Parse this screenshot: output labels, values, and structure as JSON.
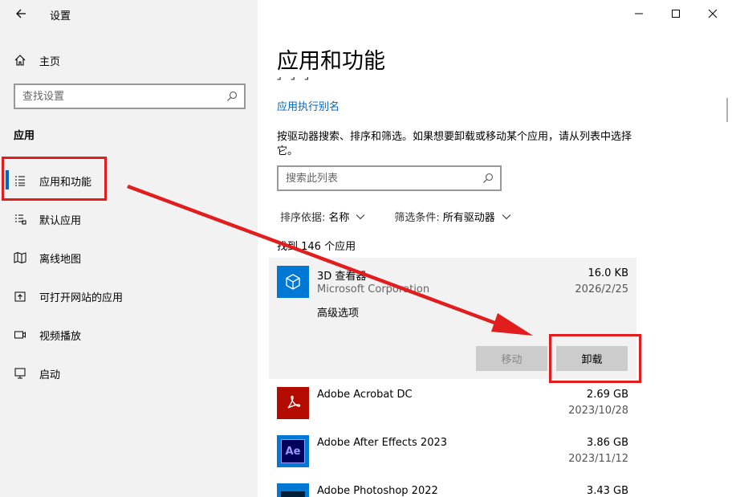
{
  "window": {
    "title": "设置"
  },
  "sidebar": {
    "home_label": "主页",
    "search_placeholder": "查找设置",
    "section_title": "应用",
    "items": [
      {
        "label": "应用和功能"
      },
      {
        "label": "默认应用"
      },
      {
        "label": "离线地图"
      },
      {
        "label": "可打开网站的应用"
      },
      {
        "label": "视频播放"
      },
      {
        "label": "启动"
      }
    ]
  },
  "main": {
    "title": "应用和功能",
    "cut_text": "」 」 」",
    "alias_link": "应用执行别名",
    "description": "按驱动器搜索、排序和筛选。如果想要卸载或移动某个应用，请从列表中选择它。",
    "list_search_placeholder": "搜索此列表",
    "sort": {
      "label": "排序依据:",
      "value": "名称"
    },
    "filter": {
      "label": "筛选条件:",
      "value": "所有驱动器"
    },
    "found_count": "找到 146 个应用",
    "apps": [
      {
        "name": "3D 查看器",
        "publisher": "Microsoft Corporation",
        "size": "16.0 KB",
        "date": "2026/2/25",
        "advanced": "高级选项",
        "icon": "3d-viewer-icon"
      },
      {
        "name": "Adobe Acrobat DC",
        "size": "2.69 GB",
        "date": "2023/10/28",
        "icon": "acrobat-icon"
      },
      {
        "name": "Adobe After Effects 2023",
        "size": "3.86 GB",
        "date": "2023/11/12",
        "icon": "after-effects-icon",
        "icon_text": "Ae"
      },
      {
        "name": "Adobe Photoshop 2022",
        "size": "3.43 GB",
        "icon": "photoshop-icon"
      }
    ],
    "buttons": {
      "move": "移动",
      "uninstall": "卸载"
    }
  },
  "colors": {
    "accent": "#0067c0",
    "highlight": "#e11d1d",
    "sidebar_bg": "#f2f2f2"
  }
}
